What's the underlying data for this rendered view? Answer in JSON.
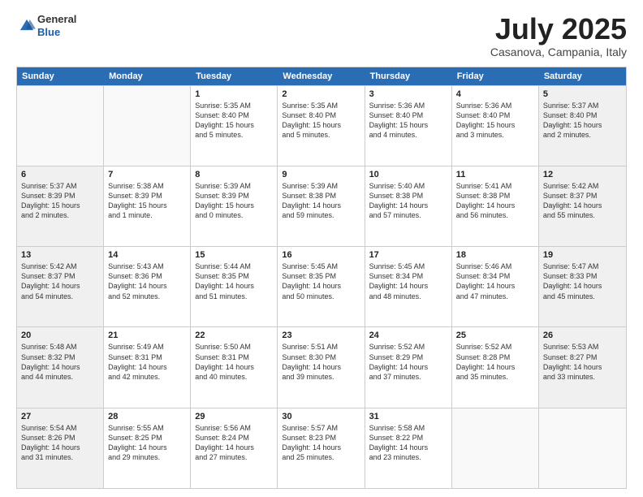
{
  "header": {
    "logo_general": "General",
    "logo_blue": "Blue",
    "month_title": "July 2025",
    "subtitle": "Casanova, Campania, Italy"
  },
  "days_of_week": [
    "Sunday",
    "Monday",
    "Tuesday",
    "Wednesday",
    "Thursday",
    "Friday",
    "Saturday"
  ],
  "weeks": [
    [
      {
        "day": "",
        "info": "",
        "empty": true
      },
      {
        "day": "",
        "info": "",
        "empty": true
      },
      {
        "day": "1",
        "info": "Sunrise: 5:35 AM\nSunset: 8:40 PM\nDaylight: 15 hours\nand 5 minutes."
      },
      {
        "day": "2",
        "info": "Sunrise: 5:35 AM\nSunset: 8:40 PM\nDaylight: 15 hours\nand 5 minutes."
      },
      {
        "day": "3",
        "info": "Sunrise: 5:36 AM\nSunset: 8:40 PM\nDaylight: 15 hours\nand 4 minutes."
      },
      {
        "day": "4",
        "info": "Sunrise: 5:36 AM\nSunset: 8:40 PM\nDaylight: 15 hours\nand 3 minutes."
      },
      {
        "day": "5",
        "info": "Sunrise: 5:37 AM\nSunset: 8:40 PM\nDaylight: 15 hours\nand 2 minutes."
      }
    ],
    [
      {
        "day": "6",
        "info": "Sunrise: 5:37 AM\nSunset: 8:39 PM\nDaylight: 15 hours\nand 2 minutes."
      },
      {
        "day": "7",
        "info": "Sunrise: 5:38 AM\nSunset: 8:39 PM\nDaylight: 15 hours\nand 1 minute."
      },
      {
        "day": "8",
        "info": "Sunrise: 5:39 AM\nSunset: 8:39 PM\nDaylight: 15 hours\nand 0 minutes."
      },
      {
        "day": "9",
        "info": "Sunrise: 5:39 AM\nSunset: 8:38 PM\nDaylight: 14 hours\nand 59 minutes."
      },
      {
        "day": "10",
        "info": "Sunrise: 5:40 AM\nSunset: 8:38 PM\nDaylight: 14 hours\nand 57 minutes."
      },
      {
        "day": "11",
        "info": "Sunrise: 5:41 AM\nSunset: 8:38 PM\nDaylight: 14 hours\nand 56 minutes."
      },
      {
        "day": "12",
        "info": "Sunrise: 5:42 AM\nSunset: 8:37 PM\nDaylight: 14 hours\nand 55 minutes."
      }
    ],
    [
      {
        "day": "13",
        "info": "Sunrise: 5:42 AM\nSunset: 8:37 PM\nDaylight: 14 hours\nand 54 minutes."
      },
      {
        "day": "14",
        "info": "Sunrise: 5:43 AM\nSunset: 8:36 PM\nDaylight: 14 hours\nand 52 minutes."
      },
      {
        "day": "15",
        "info": "Sunrise: 5:44 AM\nSunset: 8:35 PM\nDaylight: 14 hours\nand 51 minutes."
      },
      {
        "day": "16",
        "info": "Sunrise: 5:45 AM\nSunset: 8:35 PM\nDaylight: 14 hours\nand 50 minutes."
      },
      {
        "day": "17",
        "info": "Sunrise: 5:45 AM\nSunset: 8:34 PM\nDaylight: 14 hours\nand 48 minutes."
      },
      {
        "day": "18",
        "info": "Sunrise: 5:46 AM\nSunset: 8:34 PM\nDaylight: 14 hours\nand 47 minutes."
      },
      {
        "day": "19",
        "info": "Sunrise: 5:47 AM\nSunset: 8:33 PM\nDaylight: 14 hours\nand 45 minutes."
      }
    ],
    [
      {
        "day": "20",
        "info": "Sunrise: 5:48 AM\nSunset: 8:32 PM\nDaylight: 14 hours\nand 44 minutes."
      },
      {
        "day": "21",
        "info": "Sunrise: 5:49 AM\nSunset: 8:31 PM\nDaylight: 14 hours\nand 42 minutes."
      },
      {
        "day": "22",
        "info": "Sunrise: 5:50 AM\nSunset: 8:31 PM\nDaylight: 14 hours\nand 40 minutes."
      },
      {
        "day": "23",
        "info": "Sunrise: 5:51 AM\nSunset: 8:30 PM\nDaylight: 14 hours\nand 39 minutes."
      },
      {
        "day": "24",
        "info": "Sunrise: 5:52 AM\nSunset: 8:29 PM\nDaylight: 14 hours\nand 37 minutes."
      },
      {
        "day": "25",
        "info": "Sunrise: 5:52 AM\nSunset: 8:28 PM\nDaylight: 14 hours\nand 35 minutes."
      },
      {
        "day": "26",
        "info": "Sunrise: 5:53 AM\nSunset: 8:27 PM\nDaylight: 14 hours\nand 33 minutes."
      }
    ],
    [
      {
        "day": "27",
        "info": "Sunrise: 5:54 AM\nSunset: 8:26 PM\nDaylight: 14 hours\nand 31 minutes."
      },
      {
        "day": "28",
        "info": "Sunrise: 5:55 AM\nSunset: 8:25 PM\nDaylight: 14 hours\nand 29 minutes."
      },
      {
        "day": "29",
        "info": "Sunrise: 5:56 AM\nSunset: 8:24 PM\nDaylight: 14 hours\nand 27 minutes."
      },
      {
        "day": "30",
        "info": "Sunrise: 5:57 AM\nSunset: 8:23 PM\nDaylight: 14 hours\nand 25 minutes."
      },
      {
        "day": "31",
        "info": "Sunrise: 5:58 AM\nSunset: 8:22 PM\nDaylight: 14 hours\nand 23 minutes."
      },
      {
        "day": "",
        "info": "",
        "empty": true
      },
      {
        "day": "",
        "info": "",
        "empty": true
      }
    ]
  ]
}
